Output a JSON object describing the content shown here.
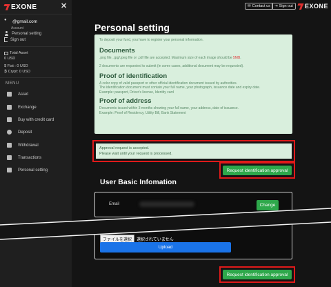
{
  "brand": {
    "name": "EXONE",
    "accent": "#e03030"
  },
  "sidebar": {
    "close_icon": "close-icon",
    "account": {
      "email": "@gmail.com",
      "label": "Account",
      "links": [
        {
          "label": "Personal setting",
          "icon": "person-icon"
        },
        {
          "label": "Sign out",
          "icon": "signout-icon"
        }
      ]
    },
    "assets": {
      "total_label": "Total Asset",
      "total_value": "0 USD",
      "fiat_line": "$ Fiat : 0 USD",
      "crypt_line": "₿ Crypt: 0 USD"
    },
    "menu_title": "MENU",
    "menu": [
      {
        "label": "Asset",
        "icon": "asset-icon"
      },
      {
        "label": "Exchange",
        "icon": "exchange-icon"
      },
      {
        "label": "Buy with credit card",
        "icon": "credit-card-icon"
      },
      {
        "label": "Deposit",
        "icon": "deposit-icon"
      },
      {
        "label": "Withdrawal",
        "icon": "withdrawal-icon"
      },
      {
        "label": "Transactions",
        "icon": "transactions-icon"
      },
      {
        "label": "Personal setting",
        "icon": "settings-icon"
      }
    ]
  },
  "topbar": {
    "contact_label": "Contact us",
    "signout_label": "Sign out"
  },
  "main": {
    "title": "Personal setting",
    "info": {
      "intro": "To deposit your fund, you have to register your personal information.",
      "documents_heading": "Documents",
      "documents_line1_a": ".png file, .jpg/.jpeg file or .pdf file are accepted. Maximum size of each image should be ",
      "documents_line1_b": "5MB",
      "documents_line1_c": ".",
      "documents_line2": "2 documents are requested to submit (in some cases, additional document may be requested).",
      "poi_heading": "Proof of identification",
      "poi_line1": "A color copy of valid passport or other official identification document issued by authorities.",
      "poi_line2": "The identification document must contain your full name, your photograph, issuance date and expiry date.",
      "poi_line3": "Example: passport, Driver's license, Identity card",
      "poa_heading": "Proof of address",
      "poa_line1": "Documents issued within 3 months showing your full name, your address, date of issuance.",
      "poa_line2": "Example: Proof of Residency, Utility Bill, Bank Statement"
    },
    "approval": {
      "line1": "Approval request is accepted.",
      "line2": "Please wait until your request is processed."
    },
    "request_button": "Request identification approval",
    "basic_info_title": "User Basic Infomation",
    "email_label": "Email",
    "change_button": "Change",
    "file_choose_label": "ファイルを選択",
    "file_none_text": "選択されていません",
    "upload_button": "Upload",
    "request_button_bottom": "Request identification approval"
  }
}
